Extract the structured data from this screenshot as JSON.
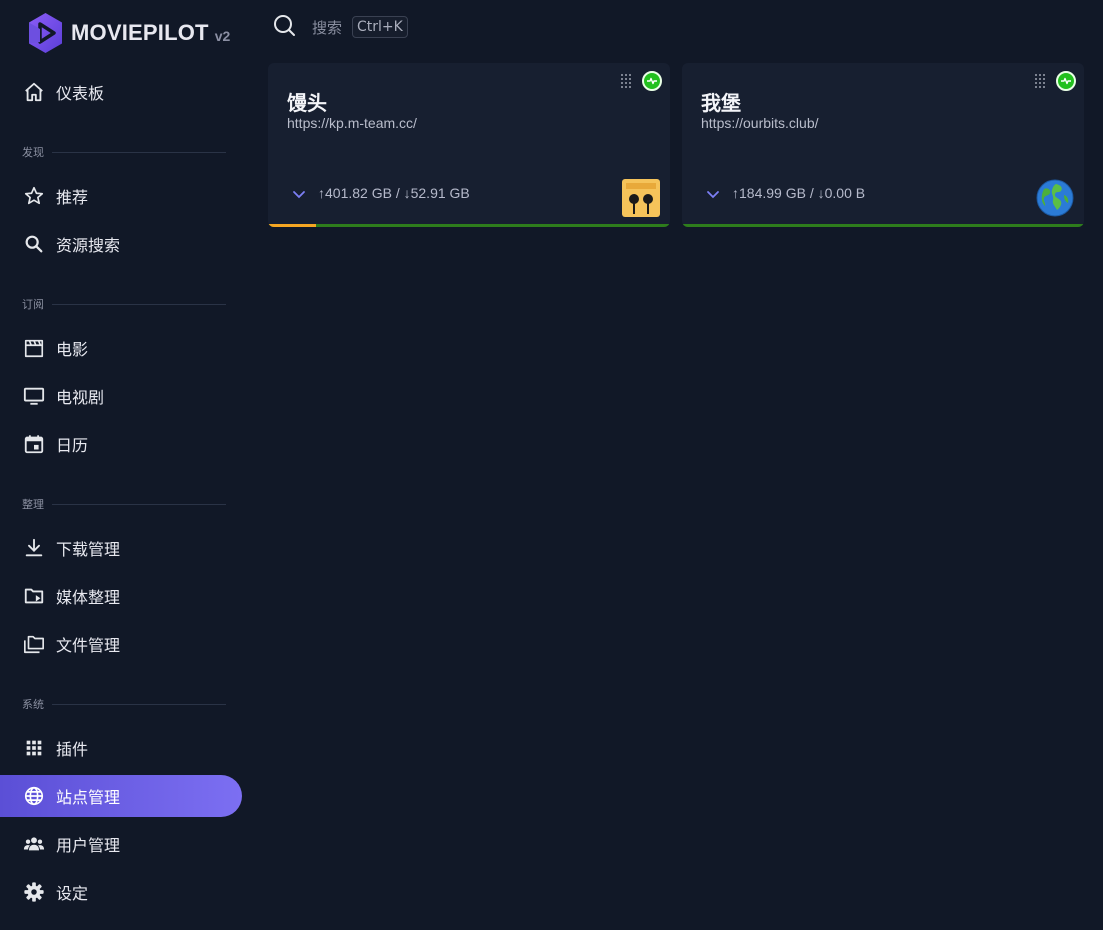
{
  "app": {
    "brand": "MOVIEPILOT",
    "version": "v2"
  },
  "sidebar": {
    "items": [
      {
        "label": "仪表板",
        "icon": "home-icon"
      },
      {
        "section": "发现"
      },
      {
        "label": "推荐",
        "icon": "star-icon"
      },
      {
        "label": "资源搜索",
        "icon": "search-icon"
      },
      {
        "section": "订阅"
      },
      {
        "label": "电影",
        "icon": "clapperboard-icon"
      },
      {
        "label": "电视剧",
        "icon": "tv-icon"
      },
      {
        "label": "日历",
        "icon": "calendar-icon"
      },
      {
        "section": "整理"
      },
      {
        "label": "下载管理",
        "icon": "download-icon"
      },
      {
        "label": "媒体整理",
        "icon": "folder-play-icon"
      },
      {
        "label": "文件管理",
        "icon": "folders-icon"
      },
      {
        "section": "系统"
      },
      {
        "label": "插件",
        "icon": "grid-icon"
      },
      {
        "label": "站点管理",
        "icon": "globe-icon",
        "active": true
      },
      {
        "label": "用户管理",
        "icon": "users-icon"
      },
      {
        "label": "设定",
        "icon": "gear-icon"
      }
    ]
  },
  "search": {
    "placeholder": "搜索",
    "shortcut": "Ctrl+K"
  },
  "sites": [
    {
      "name": "馒头",
      "url": "https://kp.m-team.cc/",
      "traffic": "↑401.82 GB / ↓52.91 GB",
      "ratio_fill": 0.12,
      "logo_icon": "mteam-logo-icon",
      "status_icon": "activity-icon"
    },
    {
      "name": "我堡",
      "url": "https://ourbits.club/",
      "traffic": "↑184.99 GB / ↓0.00 B",
      "ratio_fill": 0,
      "logo_icon": "earth-globe-icon",
      "status_icon": "activity-icon"
    }
  ],
  "colors": {
    "background": "#111827",
    "card": "#171f30",
    "accent": "#6c5ce7",
    "status_green": "#22c01e",
    "ratio_orange": "#f5a623",
    "ratio_green": "#2e7d1c"
  }
}
